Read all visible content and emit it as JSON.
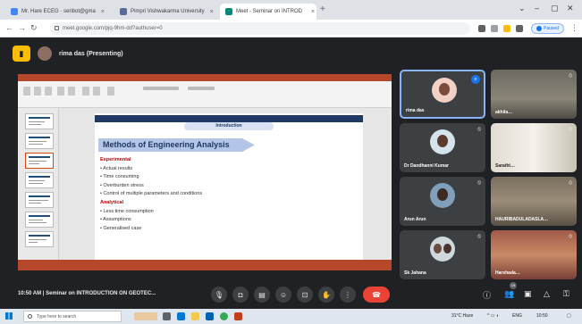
{
  "browser": {
    "tabs": [
      {
        "label": "Mr. Hare ECEG · seribot@gma",
        "active": false,
        "color": "#4285f4"
      },
      {
        "label": "Pimpri Vishwakarma University",
        "active": false,
        "color": "#5b6b9a"
      },
      {
        "label": "Meet - Seminar on INTROD",
        "active": true,
        "color": "#00897b"
      }
    ],
    "url": "meet.google.com/pjq-9hm-dd?authuser=0",
    "profile_status": "Paused"
  },
  "meet": {
    "presenter_label": "rima das (Presenting)",
    "time": "10:50 AM",
    "meeting_title": "Seminar on INTRODUCTION ON GEOTEC...",
    "participant_count": "19",
    "participants": [
      {
        "name": "rima das",
        "kind": "avatar",
        "active": true
      },
      {
        "name": "akhila…",
        "kind": "camera"
      },
      {
        "name": "Dr Dandhanni Kumar",
        "kind": "avatar"
      },
      {
        "name": "Sarathi…",
        "kind": "camera"
      },
      {
        "name": "Arun Arun",
        "kind": "avatar"
      },
      {
        "name": "HAURIBADULADASLA…",
        "kind": "camera"
      },
      {
        "name": "Sk Jahana",
        "kind": "avatar"
      },
      {
        "name": "Harshada…",
        "kind": "camera"
      }
    ]
  },
  "slide": {
    "section": "Introduction",
    "title": "Methods of Engineering Analysis",
    "items": [
      {
        "text": "Experimental",
        "head": true
      },
      {
        "text": "• Actual results",
        "head": false
      },
      {
        "text": "• Time consuming",
        "head": false
      },
      {
        "text": "• Overburden stress",
        "head": false
      },
      {
        "text": "• Control of multiple parameters and conditions",
        "head": false
      },
      {
        "text": "Analytical",
        "head": true
      },
      {
        "text": "• Less time consumption",
        "head": false
      },
      {
        "text": "• Assumptions",
        "head": false
      },
      {
        "text": "• Generalised case",
        "head": false
      }
    ]
  },
  "taskbar": {
    "search_placeholder": "Type here to search",
    "weather": "31°C Haze",
    "lang": "ENG",
    "clock": "10:50"
  },
  "colors": {
    "meet_bg": "#202124",
    "end_call": "#ea4335",
    "ppt_accent": "#b7472a",
    "active_border": "#8ab4f8"
  }
}
